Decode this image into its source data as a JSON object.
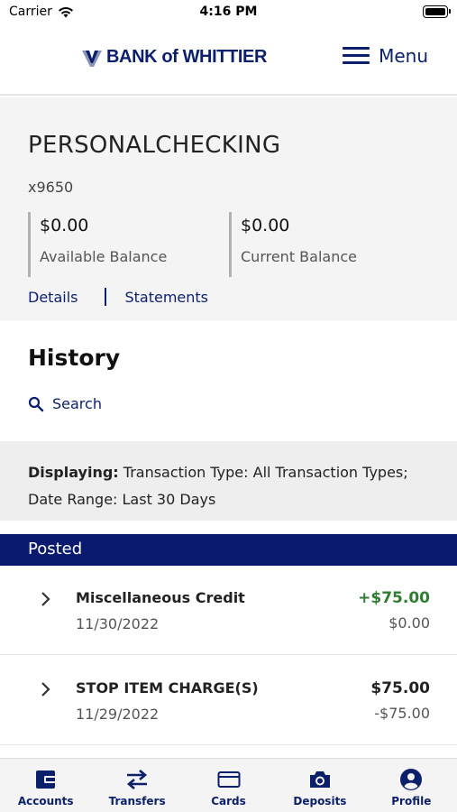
{
  "status_bar": {
    "carrier": "Carrier",
    "time": "4:16 PM"
  },
  "header": {
    "logo_text": "BANK of WHITTIER",
    "menu_label": "Menu"
  },
  "account": {
    "name": "PERSONALCHECKING",
    "number": "x9650",
    "available_amount": "$0.00",
    "available_label": "Available Balance",
    "current_amount": "$0.00",
    "current_label": "Current Balance",
    "details_link": "Details",
    "statements_link": "Statements"
  },
  "history": {
    "title": "History",
    "search_label": "Search",
    "filter_prefix": "Displaying:",
    "filter_type": " Transaction Type: All Transaction Types;",
    "filter_range": "Date Range: Last 30 Days",
    "section_label": "Posted"
  },
  "transactions": [
    {
      "name": "Miscellaneous Credit",
      "date": "11/30/2022",
      "amount": "+$75.00",
      "balance": "$0.00",
      "color": "#2e7d32"
    },
    {
      "name": "STOP ITEM CHARGE(S)",
      "date": "11/29/2022",
      "amount": "$75.00",
      "balance": "-$75.00",
      "color": "#222222"
    }
  ],
  "tabs": [
    {
      "label": "Accounts",
      "icon": "wallet-icon"
    },
    {
      "label": "Transfers",
      "icon": "transfer-arrows-icon"
    },
    {
      "label": "Cards",
      "icon": "card-icon"
    },
    {
      "label": "Deposits",
      "icon": "camera-icon"
    },
    {
      "label": "Profile",
      "icon": "profile-icon"
    }
  ],
  "colors": {
    "brand": "#0b1f6b",
    "posted_bar": "#0a1a6f",
    "credit": "#2e7d32"
  }
}
